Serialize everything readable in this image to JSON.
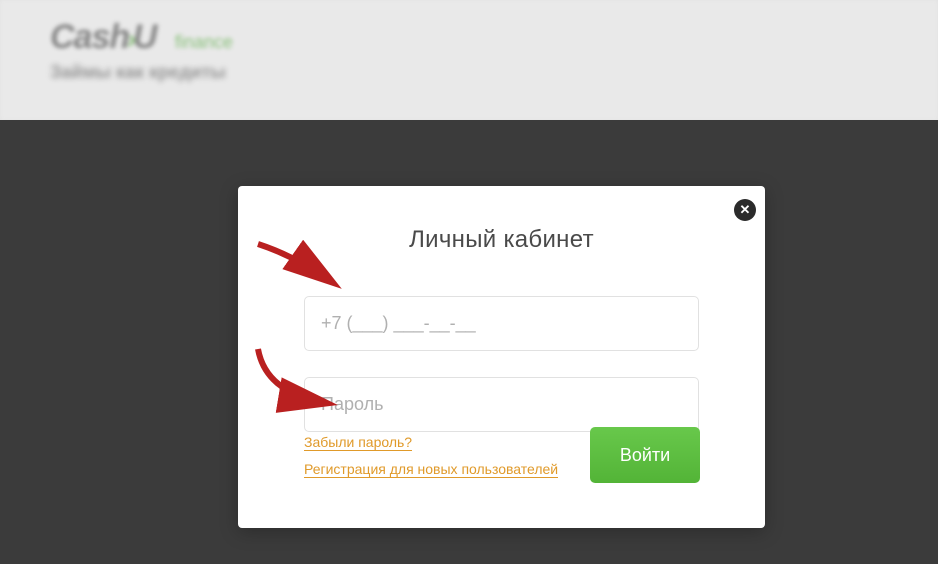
{
  "header": {
    "logo_main": "Cash",
    "logo_u": "U",
    "logo_suffix": "finance",
    "logo_sub": "Займы как кредиты"
  },
  "modal": {
    "title": "Личный кабинет",
    "phone_placeholder": "+7 (___) ___-__-__",
    "password_placeholder": "Пароль",
    "forgot_password": "Забыли пароль?",
    "register_link": "Регистрация для новых пользователей",
    "login_button": "Войти",
    "close_label": "✕"
  }
}
